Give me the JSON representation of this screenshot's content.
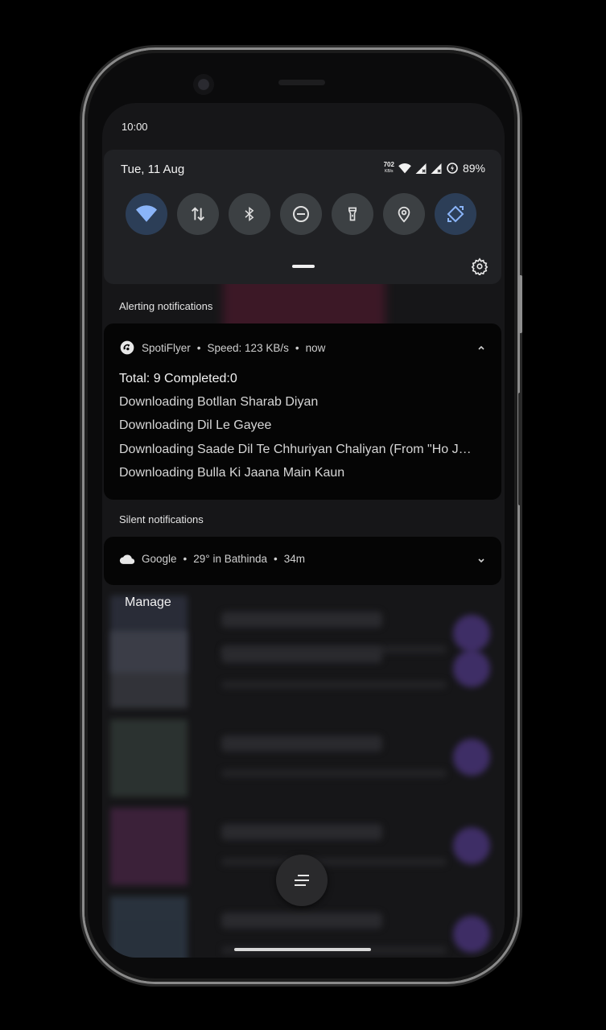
{
  "status_bar": {
    "time": "10:00"
  },
  "quick_settings": {
    "date": "Tue, 11 Aug",
    "net_speed_value": "702",
    "net_speed_unit": "KB/s",
    "battery": "89%",
    "tiles": [
      {
        "name": "wifi",
        "icon": "wifi-icon",
        "active": true
      },
      {
        "name": "mobile-data",
        "icon": "data-arrows-icon",
        "active": false
      },
      {
        "name": "bluetooth",
        "icon": "bluetooth-icon",
        "active": false
      },
      {
        "name": "do-not-disturb",
        "icon": "dnd-icon",
        "active": false
      },
      {
        "name": "flashlight",
        "icon": "flashlight-icon",
        "active": false
      },
      {
        "name": "location",
        "icon": "location-icon",
        "active": false
      },
      {
        "name": "auto-rotate",
        "icon": "rotate-icon",
        "active": true
      }
    ],
    "colors": {
      "active_icon": "#8ab4f8",
      "panel": "#202124"
    }
  },
  "alerting": {
    "label": "Alerting notifications",
    "notification": {
      "app": "SpotiFlyer",
      "detail": "Speed: 123 KB/s",
      "time": "now",
      "title": "Total: 9  Completed:0",
      "lines": [
        "Downloading Botllan Sharab Diyan",
        "Downloading Dil Le Gayee",
        "Downloading Saade Dil Te Chhuriyan Chaliyan (From \"Ho J…",
        "Downloading Bulla Ki Jaana Main Kaun"
      ]
    }
  },
  "silent": {
    "label": "Silent notifications",
    "notification": {
      "app": "Google",
      "detail": "29° in Bathinda",
      "time": "34m"
    }
  },
  "manage_label": "Manage",
  "separator": "•"
}
